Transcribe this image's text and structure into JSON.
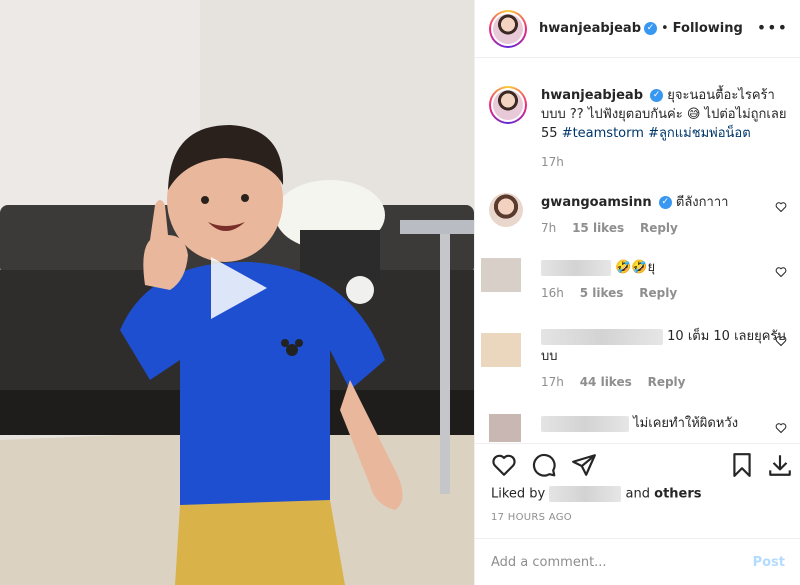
{
  "header": {
    "username": "hwanjeabjeab",
    "separator": "•",
    "follow_state": "Following",
    "more_glyph": "•••"
  },
  "caption": {
    "username": "hwanjeabjeab",
    "text": "ยุจะนอนตื้อะไรคร้าบบบ ?? ไปฟังยุตอบกันค่ะ 😅 ไปต่อไม่ถูกเลย 55",
    "hashtags": [
      "#teamstorm",
      "#ลูกแม่ชมพ่อน็อต"
    ],
    "time": "17h"
  },
  "comments": [
    {
      "username": "gwangoamsinn",
      "text": "ตีลังกาาา",
      "time": "7h",
      "likes": "15 likes",
      "reply": "Reply"
    },
    {
      "username": "",
      "text": "🤣🤣ยุ",
      "time": "16h",
      "likes": "5 likes",
      "reply": "Reply"
    },
    {
      "username": "",
      "text": "10 เต็ม 10 เลยยุครับบบ",
      "time": "17h",
      "likes": "44 likes",
      "reply": "Reply"
    },
    {
      "username": "",
      "text": "ไม่เคยทำให้ผิดหวัง",
      "time": "",
      "likes": "",
      "reply": ""
    }
  ],
  "likes": {
    "prefix": "Liked by",
    "suffix": "and",
    "others": "others"
  },
  "timestamp": "17 HOURS AGO",
  "add_comment": {
    "placeholder": "Add a comment...",
    "post_label": "Post"
  },
  "colors": {
    "verified": "#3897f0",
    "link": "#00376b",
    "muted": "#8e8e8e",
    "post_disabled": "#b3dbff"
  }
}
